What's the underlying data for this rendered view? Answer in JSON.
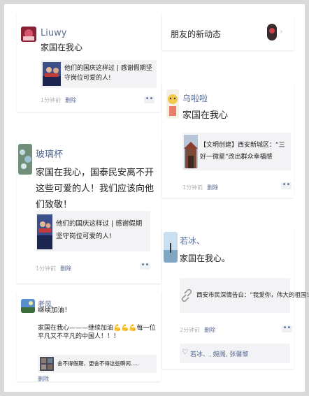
{
  "header": {
    "title": "朋友的新动态"
  },
  "posts": [
    {
      "name": "Liuwy",
      "text": "家国在我心",
      "share_title": "他们的国庆这样过 | 感谢假期坚守岗位可爱的人!",
      "time": "1分钟前",
      "delete": "删除"
    },
    {
      "name": "玻璃杯",
      "text": "家国在我心，国泰民安离不开这些可爱的人！我们应该向他们致敬！",
      "share_title": "他们的国庆这样过 | 感谢假期坚守岗位可爱的人!",
      "time": "1分钟前",
      "delete": "删除"
    },
    {
      "name": "老风",
      "text": "继续加油！",
      "share_title": "家国在我心———继续加油💪💪💪每一位平凡又不平凡的中国人！！！",
      "share_subtitle": "舍不得假期，更舍不得这些瞬间.....",
      "delete": "删除"
    },
    {
      "name": "乌啦啦",
      "text": "家国在我心",
      "share_title": "【文明创建】西安新城区：“三好一微星”改出群众幸福感",
      "time": "1分钟前",
      "delete": "删除"
    },
    {
      "name": "若冰、",
      "text": "家国在我心。",
      "share_title": "西安市民深情告白：“我爱你，伟大的祖国！”",
      "time": "2分钟前",
      "delete": "删除",
      "likes": "若冰、, 婉阁, 张馨黎"
    }
  ],
  "icons": {
    "more": "more-dots-icon",
    "link": "link-icon",
    "heart": "heart-icon",
    "chevron": "chevron-right-icon"
  },
  "colors": {
    "name_blue": "#576b95",
    "meta_gray": "#b2b2b2",
    "share_bg": "#f3f3f5"
  }
}
